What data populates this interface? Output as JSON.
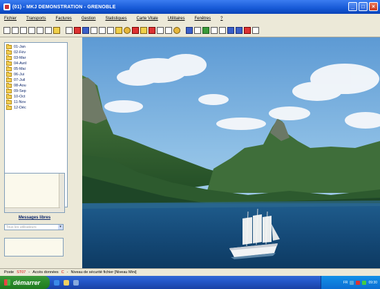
{
  "window": {
    "title": "(01) - MKJ DEMONSTRATION - GRENOBLE",
    "minimize": "_",
    "maximize": "□",
    "close": "×"
  },
  "menu": [
    "Fichier",
    "Transports",
    "Factures",
    "Gestion",
    "Statistiques",
    "Carte Vitale",
    "Utilitaires",
    "Fenêtres",
    "?"
  ],
  "toolbar_icons": [
    "new-doc-icon",
    "new-doc-icon",
    "new-doc-icon",
    "save-icon",
    "print-icon",
    "preview-icon",
    "open-folder-icon",
    "ambulance-icon",
    "taxi-icon",
    "car-icon",
    "truck-icon",
    "phone-icon",
    "calendar-icon",
    "key-icon",
    "money-icon",
    "user-icon",
    "hospital-icon",
    "globe-icon",
    "clock-icon",
    "stats-icon",
    "chart-icon",
    "card-icon",
    "screen-icon",
    "mail-icon",
    "help-icon",
    "exit-icon"
  ],
  "months": [
    "01-Jan",
    "02-Fév",
    "03-Mar",
    "04-Avril",
    "05-Mai",
    "06-Jui",
    "07-Juil",
    "08-Aou",
    "09-Sep",
    "10-Oct",
    "11-Nov",
    "12-Déc"
  ],
  "messages": {
    "title": "Messages libres",
    "select_placeholder": "Tous les utilisateurs"
  },
  "status": {
    "poste_label": "Poste",
    "poste_value": "ST07",
    "acces_label": "Accès données",
    "acces_value": "C",
    "niveau": "Niveau de sécurité fichier [Niveau Mini]"
  },
  "taskbar": {
    "start": "démarrer",
    "clock": "09:30",
    "lang": "FR"
  },
  "colors": {
    "titlebar": "#1659d6",
    "taskbar": "#2457c9",
    "start": "#2b8a2b"
  }
}
